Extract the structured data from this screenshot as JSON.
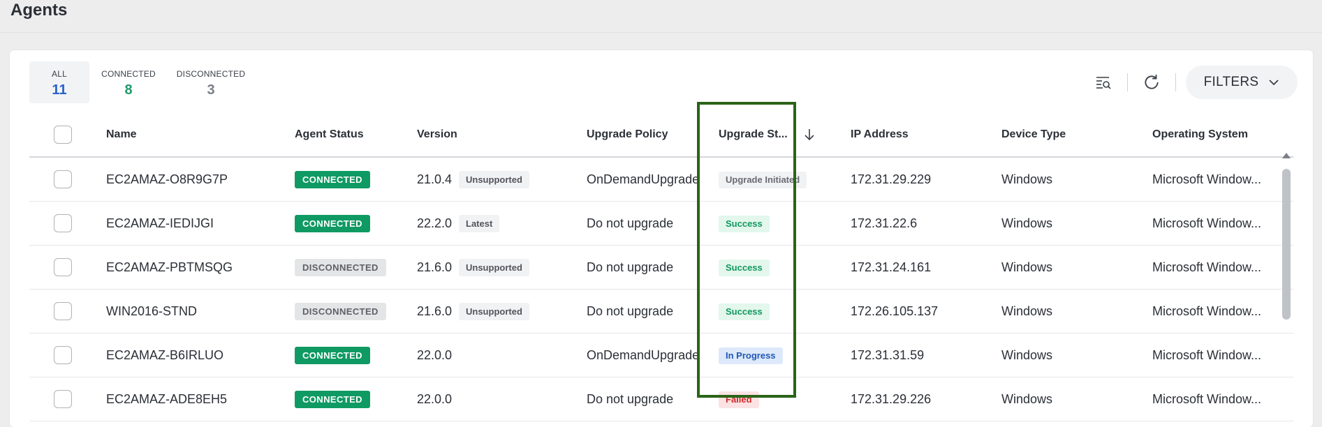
{
  "page": {
    "title": "Agents"
  },
  "counters": {
    "all": {
      "label": "ALL",
      "value": "11"
    },
    "connected": {
      "label": "CONNECTED",
      "value": "8"
    },
    "disconnected": {
      "label": "DISCONNECTED",
      "value": "3"
    }
  },
  "toolbar": {
    "filters_label": "FILTERS",
    "icons": [
      "list-search-icon",
      "refresh-icon",
      "chevron-down-icon"
    ]
  },
  "columns": {
    "name": "Name",
    "agent_status": "Agent Status",
    "version": "Version",
    "upgrade_policy": "Upgrade Policy",
    "upgrade_status": "Upgrade St...",
    "ip_address": "IP Address",
    "device_type": "Device Type",
    "operating_system": "Operating System"
  },
  "rows": [
    {
      "name": "EC2AMAZ-O8R9G7P",
      "status": "CONNECTED",
      "version": "21.0.4",
      "version_tag": "Unsupported",
      "policy": "OnDemandUpgrade",
      "upgrade_status": "Upgrade Initiated",
      "ip": "172.31.29.229",
      "device": "Windows",
      "os": "Microsoft Window..."
    },
    {
      "name": "EC2AMAZ-IEDIJGI",
      "status": "CONNECTED",
      "version": "22.2.0",
      "version_tag": "Latest",
      "policy": "Do not upgrade",
      "upgrade_status": "Success",
      "ip": "172.31.22.6",
      "device": "Windows",
      "os": "Microsoft Window..."
    },
    {
      "name": "EC2AMAZ-PBTMSQG",
      "status": "DISCONNECTED",
      "version": "21.6.0",
      "version_tag": "Unsupported",
      "policy": "Do not upgrade",
      "upgrade_status": "Success",
      "ip": "172.31.24.161",
      "device": "Windows",
      "os": "Microsoft Window..."
    },
    {
      "name": "WIN2016-STND",
      "status": "DISCONNECTED",
      "version": "21.6.0",
      "version_tag": "Unsupported",
      "policy": "Do not upgrade",
      "upgrade_status": "Success",
      "ip": "172.26.105.137",
      "device": "Windows",
      "os": "Microsoft Window..."
    },
    {
      "name": "EC2AMAZ-B6IRLUO",
      "status": "CONNECTED",
      "version": "22.0.0",
      "version_tag": "",
      "policy": "OnDemandUpgrade",
      "upgrade_status": "In Progress",
      "ip": "172.31.31.59",
      "device": "Windows",
      "os": "Microsoft Window..."
    },
    {
      "name": "EC2AMAZ-ADE8EH5",
      "status": "CONNECTED",
      "version": "22.0.0",
      "version_tag": "",
      "policy": "Do not upgrade",
      "upgrade_status": "Failed",
      "ip": "172.31.29.226",
      "device": "Windows",
      "os": "Microsoft Window..."
    }
  ],
  "colors": {
    "connected": "#0f9a63",
    "disconnected": "#e4e5e7",
    "accent_blue": "#2a62c9",
    "highlight": "#2b6418"
  }
}
